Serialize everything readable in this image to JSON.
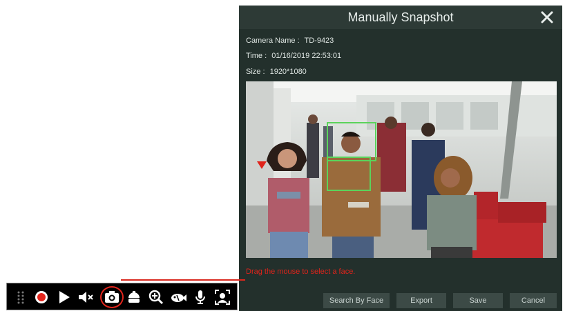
{
  "dialog": {
    "title": "Manually Snapshot",
    "camera_name_label": "Camera Name :",
    "camera_name_value": "TD-9423",
    "time_label": "Time :",
    "time_value": "01/16/2019 22:53:01",
    "size_label": "Size :",
    "size_value": "1920*1080",
    "hint": "Drag the mouse to select a face.",
    "buttons": {
      "search_by_face": "Search By Face",
      "export": "Export",
      "save": "Save",
      "cancel": "Cancel"
    }
  },
  "toolbar": {
    "icons": [
      "drag-handle-icon",
      "record-icon",
      "play-icon",
      "mute-icon",
      "snapshot-icon",
      "ptz-icon",
      "zoom-in-icon",
      "fisheye-icon",
      "microphone-icon",
      "face-detect-icon"
    ]
  },
  "colors": {
    "dialog_bg": "#23302c",
    "header_bg": "#2d3a36",
    "accent_red": "#e0241b",
    "button_bg": "#3c4a46"
  }
}
